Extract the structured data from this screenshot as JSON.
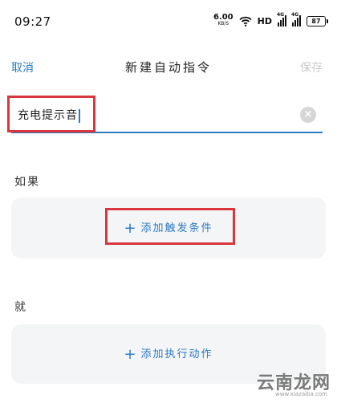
{
  "status_bar": {
    "time": "09:27",
    "net_speed": "6.00",
    "net_unit": "KB/S",
    "hd_label": "HD",
    "sig1_tag": "4G",
    "sig2_tag": "4G",
    "battery": "87"
  },
  "header": {
    "cancel_label": "取消",
    "title": "新建自动指令",
    "save_label": "保存"
  },
  "name_field": {
    "value": "充电提示音"
  },
  "if_section": {
    "label": "如果",
    "add_label": "添加触发条件"
  },
  "then_section": {
    "label": "就",
    "add_label": "添加执行动作"
  },
  "watermark": {
    "text": "云南龙网",
    "url": "www.xiazaiba.com"
  },
  "colors": {
    "accent": "#2b79c4",
    "highlight": "#d9363e",
    "card_bg": "#f4f5f6",
    "disabled": "#c9c9c9"
  },
  "icons": {
    "wifi": "wifi-icon",
    "signal": "signal-icon",
    "battery": "battery-icon",
    "clear": "clear-icon",
    "plus": "plus-icon"
  }
}
